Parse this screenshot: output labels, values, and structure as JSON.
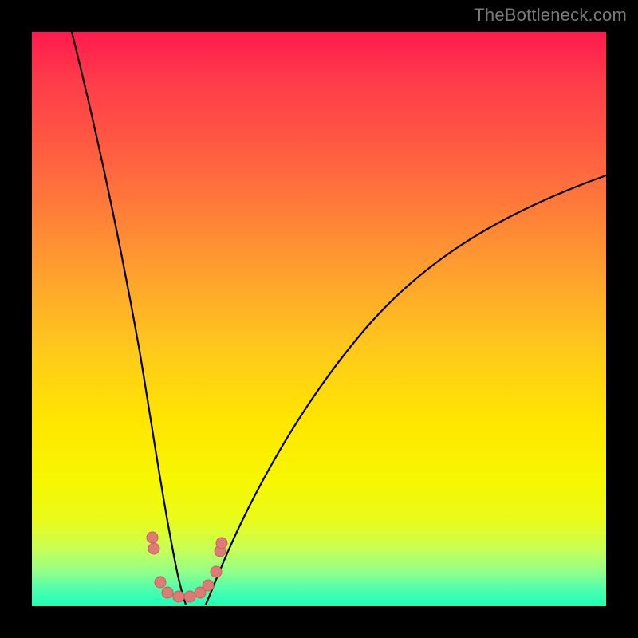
{
  "watermark": "TheBottleneck.com",
  "colors": {
    "frame": "#000000",
    "curve": "#000000",
    "dot": "#e07a76",
    "gradient_top": "#ff1a4d",
    "gradient_bottom": "#1fffb8"
  },
  "chart_data": {
    "type": "line",
    "title": "",
    "xlabel": "",
    "ylabel": "",
    "xlim": [
      0,
      100
    ],
    "ylim": [
      0,
      100
    ],
    "note": "Axes are unlabeled; values are normalized 0–100 estimates read from pixel positions. y=0 is bottom (green), y=100 is top (red). The figure shows a V-shaped bottleneck curve with minimum near x≈26–30, plus scattered salmon-colored data points near the trough.",
    "series": [
      {
        "name": "left-branch",
        "x": [
          7,
          10,
          13,
          16,
          19,
          21,
          23,
          25,
          26
        ],
        "y": [
          100,
          86,
          70,
          54,
          37,
          22,
          10,
          3,
          0
        ]
      },
      {
        "name": "right-branch",
        "x": [
          30,
          32,
          35,
          40,
          46,
          54,
          62,
          72,
          84,
          100
        ],
        "y": [
          0,
          3,
          8,
          17,
          28,
          40,
          50,
          60,
          68,
          75
        ]
      }
    ],
    "points": [
      {
        "x": 21.0,
        "y": 12.0
      },
      {
        "x": 21.3,
        "y": 10.0
      },
      {
        "x": 22.3,
        "y": 4.2
      },
      {
        "x": 23.6,
        "y": 2.3
      },
      {
        "x": 25.5,
        "y": 1.6
      },
      {
        "x": 27.5,
        "y": 1.6
      },
      {
        "x": 29.3,
        "y": 2.3
      },
      {
        "x": 30.7,
        "y": 3.6
      },
      {
        "x": 32.1,
        "y": 6.0
      },
      {
        "x": 32.8,
        "y": 9.6
      },
      {
        "x": 33.1,
        "y": 11.0
      }
    ],
    "point_radius_px": 7
  }
}
